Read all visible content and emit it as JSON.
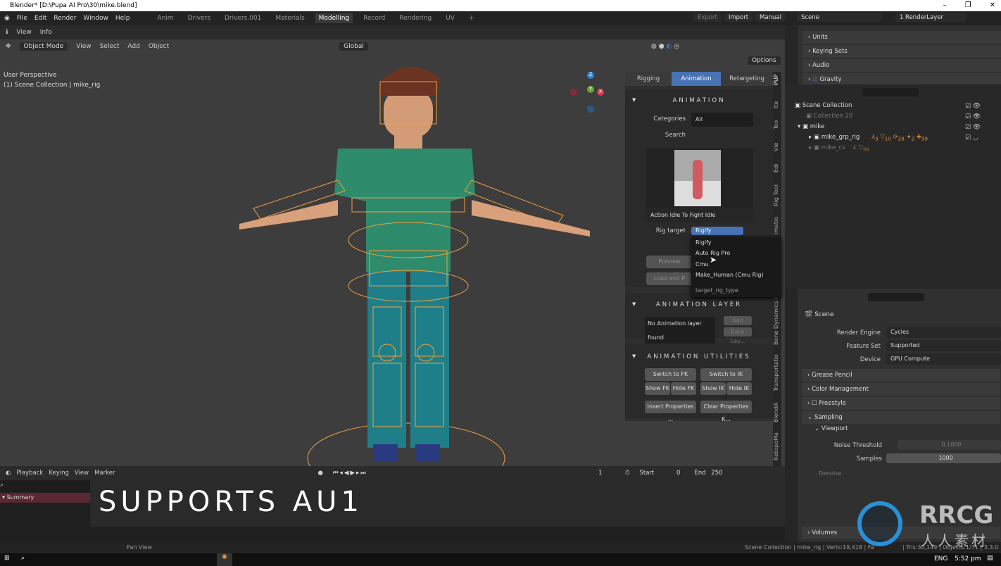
{
  "window": {
    "title": "Blender* [D:\\Pupa AI Pro\\30\\mike.blend]",
    "min": "–",
    "max": "❐",
    "close": "✕"
  },
  "menu": {
    "items": [
      "File",
      "Edit",
      "Render",
      "Window",
      "Help"
    ],
    "workspaces": [
      "Anim",
      "Drivers",
      "Drivers.001",
      "Materials",
      "Modelling",
      "Record",
      "Rendering",
      "UV",
      "+"
    ],
    "active_workspace": "Modelling",
    "export": "Export",
    "import": "Import",
    "manual": "Manual",
    "scene": "Scene",
    "render_layer": "1 RenderLayer"
  },
  "info_header": {
    "items": [
      "View",
      "Info"
    ]
  },
  "viewport": {
    "mode": "Object Mode",
    "menus": [
      "View",
      "Select",
      "Add",
      "Object"
    ],
    "orientation": "Global",
    "options": "Options",
    "perspective": "User Perspective",
    "collection": "(1) Scene Collection | mike_rig",
    "gizmo": {
      "z": "Z",
      "y": "Y",
      "x": "X"
    }
  },
  "npanel": {
    "tabs": [
      "Rigging",
      "Animation",
      "Retargeting"
    ],
    "active_tab": "Animation",
    "side_tabs": [
      "PUP",
      "Ite",
      "Too",
      "Vie",
      "Edi",
      "Rig Tool",
      "imatio",
      "Bone Dynamics P",
      "Transportatio",
      "BlendA",
      "RetopoMa"
    ],
    "animation": {
      "title": "ANIMATION",
      "categories_label": "Categories",
      "categories_value": "All",
      "search_label": "Search",
      "search_value": "",
      "action_name": "Action Idle To Fight Idle",
      "rig_target_label": "Rig target",
      "rig_target_value": "Rigify",
      "preview_btn": "Preview Animatio",
      "load_btn": "Load and P"
    },
    "dropdown": {
      "options": [
        "Rigify",
        "Auto Rig Pro",
        "Cmu",
        "Make_Human (Cmu Rig)"
      ],
      "tooltip": "target_rig_type"
    },
    "layer": {
      "title": "ANIMATION LAYER",
      "status": "No Animation layer found",
      "add": "Add Layer",
      "bake": "Bake Lay..."
    },
    "utilities": {
      "title": "ANIMATION UTILITIES",
      "switch_fk": "Switch to FK",
      "switch_ik": "Switch to IK",
      "show_fk": "Show FK",
      "hide_fk": "Hide FK",
      "show_ik": "Show IK",
      "hide_ik": "Hide IK",
      "insert": "Insert Properties ...",
      "clear": "Clear Properties K..."
    }
  },
  "scene_props": {
    "panels": [
      "Units",
      "Keying Sets",
      "Audio",
      "Gravity"
    ]
  },
  "outliner": {
    "root": "Scene Collection",
    "items": [
      {
        "name": "Collection 20"
      },
      {
        "name": "mike"
      },
      {
        "name": "mike_grp_rig",
        "badges": [
          "3",
          "10",
          "28",
          "2",
          "99"
        ]
      },
      {
        "name": "mike_cs",
        "badges": [
          "99"
        ]
      }
    ]
  },
  "properties": {
    "context": "Scene",
    "render_engine_label": "Render Engine",
    "render_engine": "Cycles",
    "feature_set_label": "Feature Set",
    "feature_set": "Supported",
    "device_label": "Device",
    "device": "GPU Compute",
    "panels": [
      "Grease Pencil",
      "Color Management",
      "Freestyle",
      "Sampling"
    ],
    "viewport_sub": "Viewport",
    "noise_label": "Noise Threshold",
    "noise": "0.1000",
    "samples_label": "Samples",
    "samples": "1000",
    "denoise": "Denoise",
    "volumes": "Volumes"
  },
  "timeline": {
    "menus": [
      "Playback",
      "Keying",
      "View",
      "Marker"
    ],
    "frame": "1",
    "start_label": "Start",
    "start": "0",
    "end_label": "End",
    "end": "250",
    "summary": "Summary",
    "overlay_caption": "SUPPORTS AU1"
  },
  "status": {
    "pan": "Pan View",
    "stats_left": "Scene Collection | mike_rig | Verts:19,418 | Fa",
    "stats_right": "| Tris:30,149 | Objects:1/71 | 3.3.0 Be"
  },
  "watermark": {
    "text": "RRCG",
    "sub": "人人素材"
  },
  "taskbar": {
    "lang": "ENG",
    "time": "5:52 pm"
  },
  "colors": {
    "accent": "#4772b3",
    "rig_orange": "#f0a040",
    "shirt": "#2e8b6b",
    "pants": "#1f7f88"
  }
}
